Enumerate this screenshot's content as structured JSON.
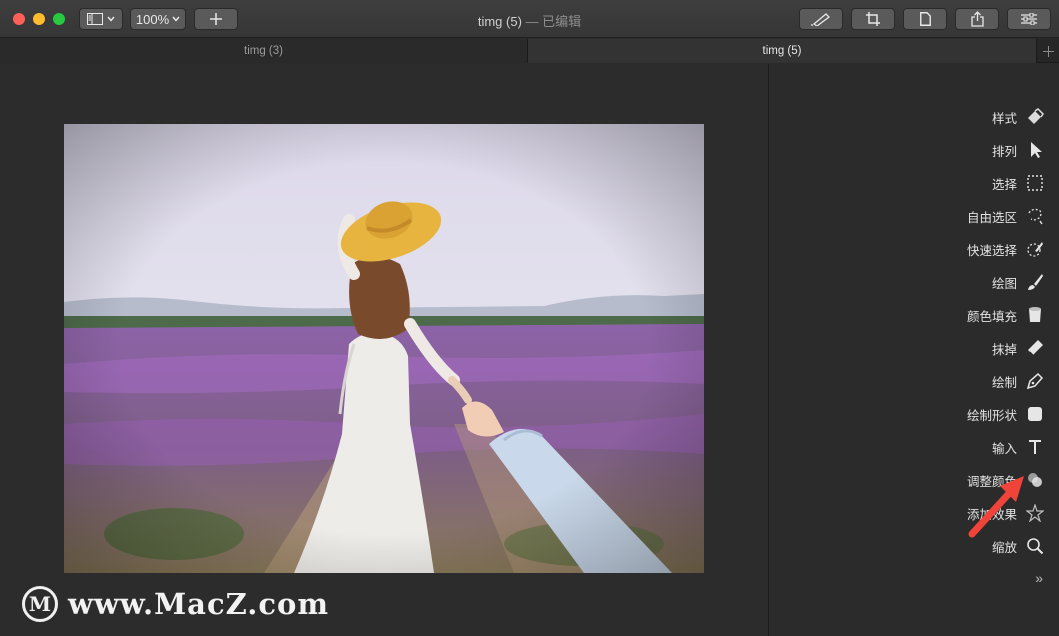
{
  "window": {
    "title": "timg (5)",
    "edited": " — 已编辑",
    "zoom": "100%"
  },
  "tabs": [
    {
      "label": "timg (3)"
    },
    {
      "label": "timg (5)"
    }
  ],
  "tools": [
    {
      "label": "样式",
      "icon": "style-icon"
    },
    {
      "label": "排列",
      "icon": "arrow-pointer-icon"
    },
    {
      "label": "选择",
      "icon": "marquee-select-icon"
    },
    {
      "label": "自由选区",
      "icon": "lasso-icon"
    },
    {
      "label": "快速选择",
      "icon": "quick-select-icon"
    },
    {
      "label": "绘图",
      "icon": "brush-icon"
    },
    {
      "label": "颜色填充",
      "icon": "paint-bucket-icon"
    },
    {
      "label": "抹掉",
      "icon": "eraser-icon"
    },
    {
      "label": "绘制",
      "icon": "pen-icon"
    },
    {
      "label": "绘制形状",
      "icon": "shape-icon"
    },
    {
      "label": "输入",
      "icon": "text-icon"
    },
    {
      "label": "调整颜色",
      "icon": "adjust-color-icon"
    },
    {
      "label": "添加效果",
      "icon": "effects-star-icon"
    },
    {
      "label": "缩放",
      "icon": "magnifier-icon"
    }
  ],
  "more_label": "»",
  "watermark": {
    "logo": "M",
    "text": "www.MacZ.com"
  },
  "colors": {
    "accent_red": "#f0443a"
  }
}
